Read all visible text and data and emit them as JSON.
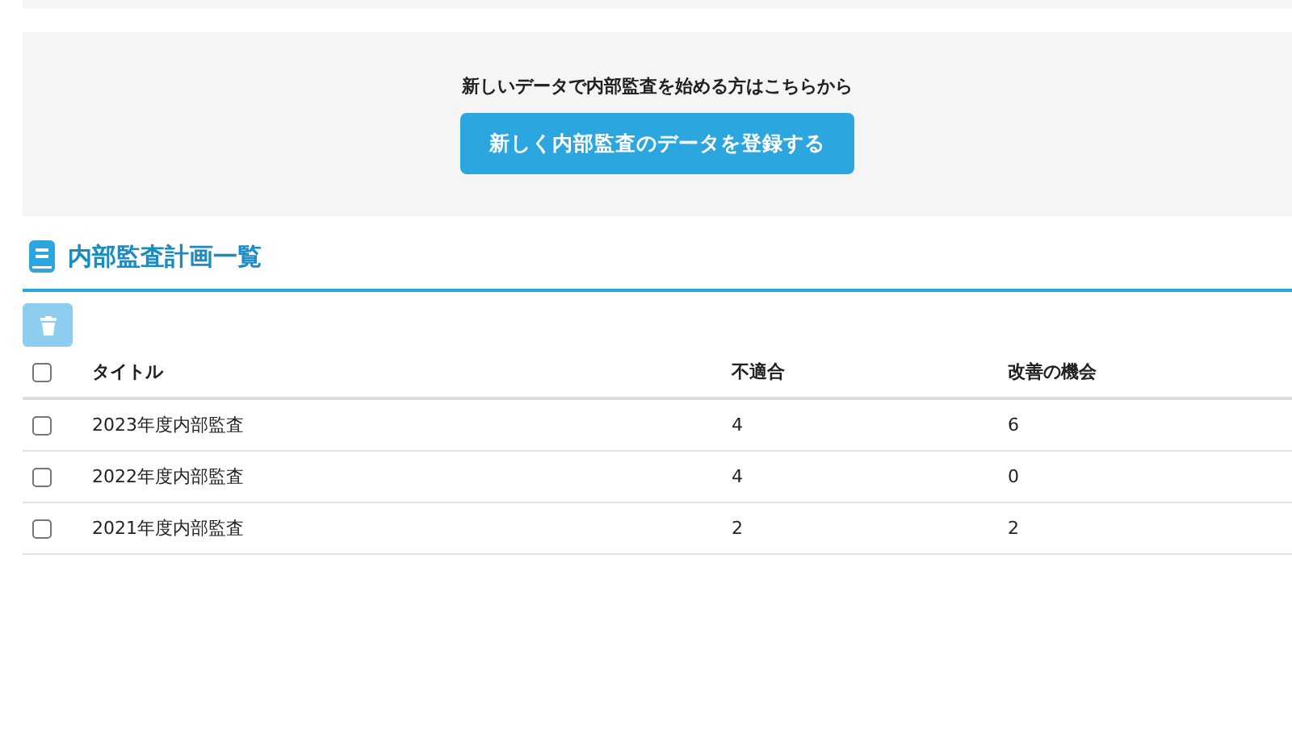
{
  "cta": {
    "prompt": "新しいデータで内部監査を始める方はこちらから",
    "button": "新しく内部監査のデータを登録する"
  },
  "section": {
    "title": "内部監査計画一覧"
  },
  "toolbar": {
    "delete_disabled": true
  },
  "table": {
    "select_all_checked": false,
    "columns": [
      "タイトル",
      "不適合",
      "改善の機会"
    ],
    "rows": [
      {
        "checked": false,
        "cells": [
          "2023年度内部監査",
          "4",
          "6"
        ]
      },
      {
        "checked": false,
        "cells": [
          "2022年度内部監査",
          "4",
          "0"
        ]
      },
      {
        "checked": false,
        "cells": [
          "2021年度内部監査",
          "2",
          "2"
        ]
      }
    ]
  }
}
